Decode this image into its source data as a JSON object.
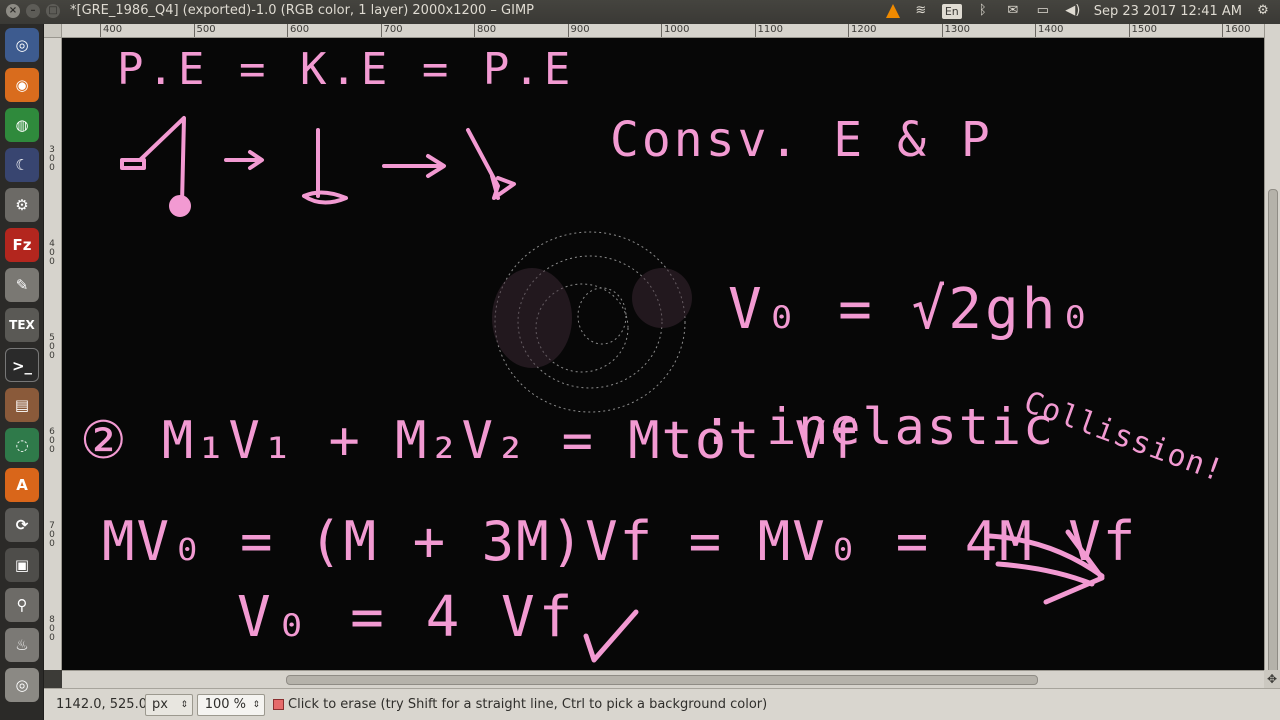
{
  "window": {
    "title": "*[GRE_1986_Q4] (exported)-1.0 (RGB color, 1 layer) 2000x1200 – GIMP"
  },
  "tray": {
    "keyboard": "En",
    "clock": "Sep 23 2017 12:41 AM"
  },
  "launcher": {
    "items": [
      "dash-home",
      "firefox",
      "chrome",
      "stellarium",
      "system-settings",
      "filezilla",
      "text-editor",
      "texmaker",
      "terminal",
      "files",
      "apps",
      "software-center",
      "updater",
      "screenshot",
      "java",
      "disks"
    ]
  },
  "ruler": {
    "horizontal": [
      "400",
      "500",
      "600",
      "700",
      "800",
      "900",
      "1000",
      "1100",
      "1200",
      "1300",
      "1400",
      "1500",
      "1600"
    ],
    "vertical": [
      "3\n0\n0",
      "4\n0\n0",
      "5\n0\n0",
      "6\n0\n0",
      "7\n0\n0",
      "8\n0\n0"
    ]
  },
  "canvas": {
    "ink_color": "#f29ad2",
    "lines": {
      "line1": "P.E = K.E = P.E",
      "conserve": "Consv. E & P",
      "v0": "V₀ = √2gh₀",
      "momentum": "② M₁V₁ + M₂V₂ = Mtot Vf",
      "inelastic": ": inelastic",
      "collision": "Collission!",
      "eq1": "MV₀ = (M + 3M)Vf = MV₀ = 4M Vf",
      "eq2": "V₀ = 4 Vf",
      "tick": "✓"
    }
  },
  "status": {
    "coords": "1142.0, 525.0",
    "unit": "px",
    "zoom": "100 %",
    "message": "Click to erase (try Shift for a straight line, Ctrl to pick a background color)"
  }
}
